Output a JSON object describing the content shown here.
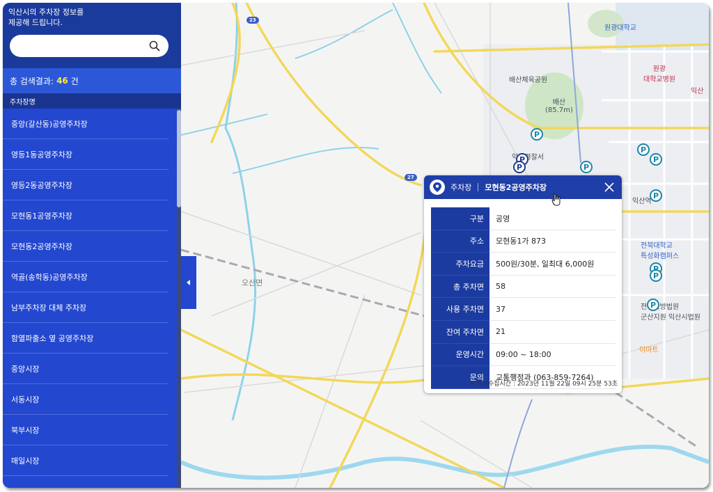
{
  "sidebar": {
    "intro": "익산시의 주차장 정보를\n제공해 드립니다.",
    "search": {
      "value": "",
      "placeholder": ""
    },
    "result_prefix": "총 검색결과:",
    "result_count": "46",
    "result_suffix": "건",
    "column_header": "주차장명",
    "items": [
      "중앙(갈산동)공영주차장",
      "영등1동공영주차장",
      "영등2동공영주차장",
      "모현동1공영주차장",
      "모현동2공영주차장",
      "역골(송학동)공영주차장",
      "남부주차장 대체 주차장",
      "함열파출소 옆 공영주차장",
      "중앙시장",
      "서동시장",
      "북부시장",
      "매일시장"
    ]
  },
  "map": {
    "labels": {
      "univ": "원광대학교",
      "hospital": "원광\n대학교병원",
      "school_partial": "익산",
      "gym": "배산체육공원",
      "mountain": "배산\n(85.7m)",
      "police": "익산경찰서",
      "station": "익산역",
      "campus": "전북대학교\n특성화캠퍼스",
      "court": "전주지방법원\n군산지원 익산시법원",
      "emart": "이마트",
      "district": "오산면"
    },
    "route_badges": [
      "23",
      "27"
    ],
    "pin_label": "P"
  },
  "popup": {
    "category": "주차장",
    "title": "모현동2공영주차장",
    "rows": [
      {
        "k": "구분",
        "v": "공영"
      },
      {
        "k": "주소",
        "v": "모현동1가 873"
      },
      {
        "k": "주차요금",
        "v": "500원/30분, 일최대 6,000원"
      },
      {
        "k": "총 주차면",
        "v": "58"
      },
      {
        "k": "사용 주차면",
        "v": "37"
      },
      {
        "k": "잔여 주차면",
        "v": "21"
      },
      {
        "k": "운영시간",
        "v": "09:00 ~ 18:00"
      },
      {
        "k": "문의",
        "v": "교통행정과 (063-859-7264)"
      }
    ],
    "collected": "※ 정보수집시간 : 2023년 11월 22일 09시 25분 53초"
  }
}
